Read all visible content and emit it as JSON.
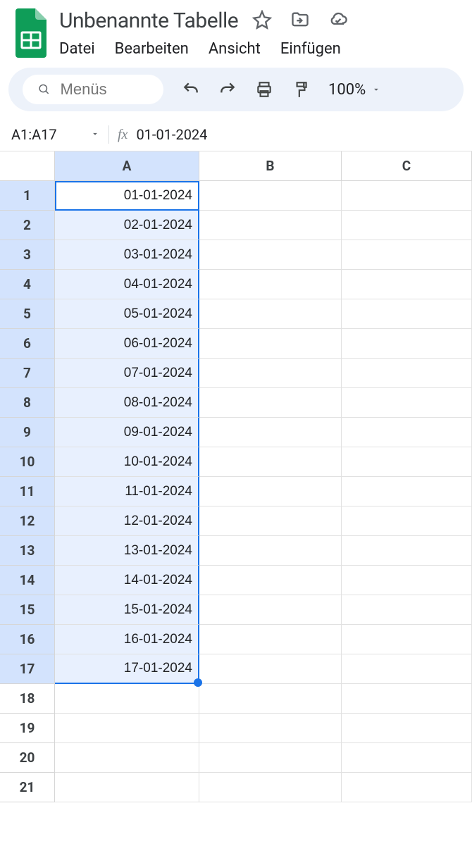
{
  "doc": {
    "title": "Unbenannte Tabelle"
  },
  "menu": {
    "file": "Datei",
    "edit": "Bearbeiten",
    "view": "Ansicht",
    "insert": "Einfügen"
  },
  "search": {
    "placeholder": "Menüs"
  },
  "zoom": {
    "label": "100%"
  },
  "nameBox": {
    "value": "A1:A17"
  },
  "formula": {
    "value": "01-01-2024"
  },
  "columns": [
    "A",
    "B",
    "C"
  ],
  "rows": [
    "1",
    "2",
    "3",
    "4",
    "5",
    "6",
    "7",
    "8",
    "9",
    "10",
    "11",
    "12",
    "13",
    "14",
    "15",
    "16",
    "17",
    "18",
    "19",
    "20",
    "21"
  ],
  "cellsA": [
    "01-01-2024",
    "02-01-2024",
    "03-01-2024",
    "04-01-2024",
    "05-01-2024",
    "06-01-2024",
    "07-01-2024",
    "08-01-2024",
    "09-01-2024",
    "10-01-2024",
    "11-01-2024",
    "12-01-2024",
    "13-01-2024",
    "14-01-2024",
    "15-01-2024",
    "16-01-2024",
    "17-01-2024",
    "",
    "",
    "",
    ""
  ],
  "selection": {
    "startRow": 1,
    "endRow": 17,
    "col": "A"
  }
}
